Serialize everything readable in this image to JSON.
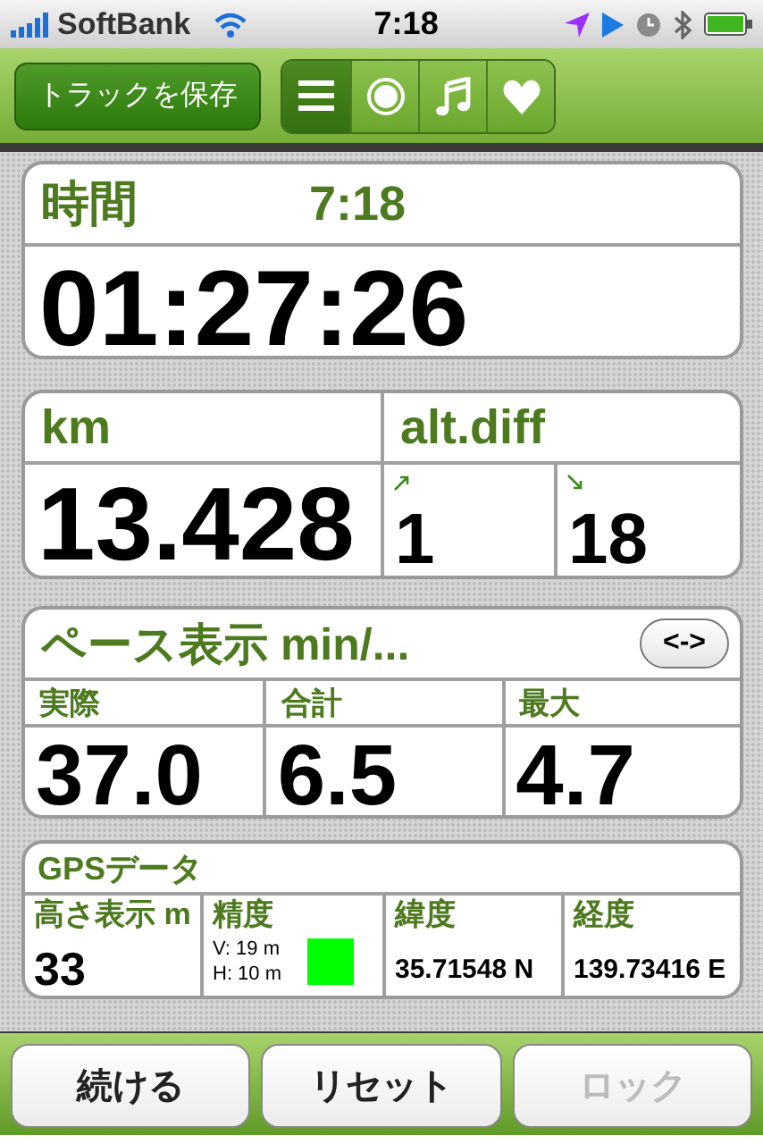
{
  "status_bar": {
    "carrier": "SoftBank",
    "time": "7:18"
  },
  "toolbar": {
    "save_button": "トラックを保存",
    "tabs": [
      {
        "kind": "list",
        "selected": true
      },
      {
        "kind": "record",
        "selected": false
      },
      {
        "kind": "music",
        "selected": false
      },
      {
        "kind": "heart",
        "selected": false
      }
    ]
  },
  "time_card": {
    "label": "時間",
    "clock": "7:18",
    "value": "01:27:26"
  },
  "distance_card": {
    "label": "km",
    "value": "13.428",
    "alt_label": "alt.diff",
    "ascent": "1",
    "descent": "18"
  },
  "pace_card": {
    "title": "ペース表示 min/...",
    "toggle": "<->",
    "cells": [
      {
        "label": "実際",
        "value": "37.0"
      },
      {
        "label": "合計",
        "value": "6.5"
      },
      {
        "label": "最大",
        "value": "4.7"
      }
    ]
  },
  "gps_card": {
    "title": "GPSデータ",
    "altitude": {
      "label": "高さ表示 m",
      "value": "33"
    },
    "accuracy": {
      "label": "精度",
      "vertical": "V: 19 m",
      "horizontal": "H: 10 m",
      "color": "#00ff00"
    },
    "latitude": {
      "label": "緯度",
      "value": "35.71548 N"
    },
    "longitude": {
      "label": "経度",
      "value": "139.73416 E"
    }
  },
  "buttons": [
    {
      "label": "続ける",
      "disabled": false
    },
    {
      "label": "リセット",
      "disabled": false
    },
    {
      "label": "ロック",
      "disabled": true
    }
  ]
}
